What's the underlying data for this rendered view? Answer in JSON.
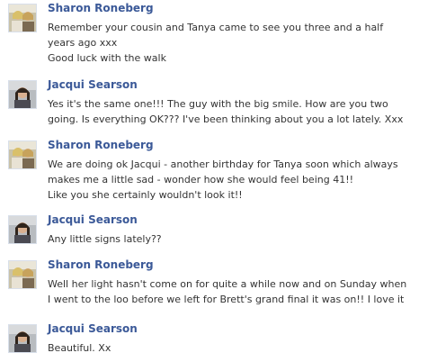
{
  "messages": [
    {
      "author": "Sharon Roneberg",
      "avatar": "sharon-avatar",
      "lines": [
        "Remember your cousin and Tanya came to see you three and a half",
        "years ago  xxx",
        "Good luck with the walk"
      ]
    },
    {
      "author": "Jacqui Searson",
      "avatar": "jacqui-avatar",
      "lines": [
        "Yes it's the same one!!! The guy with the big smile. How are you two",
        "going. Is everything OK??? I've been thinking about you a lot lately. Xxx"
      ]
    },
    {
      "author": "Sharon Roneberg",
      "avatar": "sharon-avatar",
      "lines": [
        "We are doing ok Jacqui - another birthday for Tanya soon which always",
        "makes me a little sad - wonder how she would feel being 41!!",
        "Like you she certainly wouldn't look it!!"
      ]
    },
    {
      "author": "Jacqui Searson",
      "avatar": "jacqui-avatar",
      "lines": [
        "Any little signs lately??"
      ]
    },
    {
      "author": "Sharon Roneberg",
      "avatar": "sharon-avatar",
      "lines": [
        "Well her light hasn't come on for quite a while now and on Sunday when",
        "I went to the loo before we left for Brett's grand final it was on!! I love it"
      ]
    },
    {
      "author": "Jacqui Searson",
      "avatar": "jacqui-avatar",
      "lines": [
        "Beautiful. Xx"
      ]
    }
  ]
}
